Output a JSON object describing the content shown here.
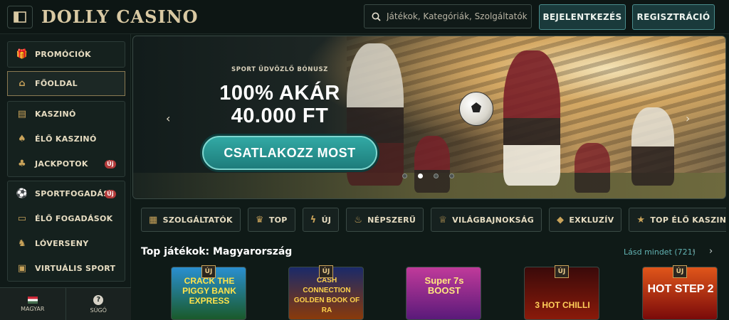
{
  "header": {
    "logo": "DOLLY CASINO",
    "search_placeholder": "Játékok, Kategóriák, Szolgáltatók",
    "login_label": "BEJELENTKEZÉS",
    "register_label": "REGISZTRÁCIÓ"
  },
  "sidebar": {
    "groups": [
      [
        {
          "label": "PROMÓCIÓK",
          "icon": "gift-icon"
        }
      ],
      [
        {
          "label": "FŐOLDAL",
          "icon": "home-icon",
          "active": true
        }
      ],
      [
        {
          "label": "KASZINÓ",
          "icon": "casino-icon"
        },
        {
          "label": "ÉLŐ KASZINÓ",
          "icon": "cards-icon"
        },
        {
          "label": "JACKPOTOK",
          "icon": "clover-icon",
          "badge": "Új"
        }
      ],
      [
        {
          "label": "SPORTFOGADÁS",
          "icon": "soccer-ball-icon",
          "badge": "Új"
        },
        {
          "label": "ÉLŐ FOGADÁSOK",
          "icon": "ticket-icon"
        },
        {
          "label": "LÓVERSENY",
          "icon": "horse-icon"
        },
        {
          "label": "VIRTUÁLIS SPORT",
          "icon": "tv-icon"
        }
      ]
    ],
    "language_label": "MAGYAR",
    "help_label": "SÚGÓ"
  },
  "banner": {
    "subtitle": "SPORT ÜDVÖZLŐ BÓNUSZ",
    "title_line1": "100% AKÁR",
    "title_line2": "40.000 FT",
    "cta_label": "CSATLAKOZZ MOST",
    "slides": 4,
    "active_slide": 2
  },
  "categories": [
    {
      "label": "SZOLGÁLTATÓK",
      "icon": "providers-icon"
    },
    {
      "label": "TOP",
      "icon": "trophy-icon"
    },
    {
      "label": "ÚJ",
      "icon": "lightning-icon"
    },
    {
      "label": "NÉPSZERŰ",
      "icon": "flame-icon"
    },
    {
      "label": "VILÁGBAJNOKSÁG",
      "icon": "world-cup-icon"
    },
    {
      "label": "EXKLUZÍV",
      "icon": "diamond-icon"
    },
    {
      "label": "TOP ÉLŐ KASZINÓ",
      "icon": "star-icon"
    }
  ],
  "top_games": {
    "title": "Top játékok: Magyarország",
    "see_all": "Lásd mindet (721)",
    "new_tag": "ÚJ",
    "games": [
      {
        "title": "CRACK THE PIGGY BANK EXPRESS"
      },
      {
        "title": "CASH CONNECTION GOLDEN BOOK OF RA"
      },
      {
        "title": "Super 7s BOOST"
      },
      {
        "title": "3 HOT CHILLI"
      },
      {
        "title": "HOT STEP 2"
      }
    ]
  }
}
